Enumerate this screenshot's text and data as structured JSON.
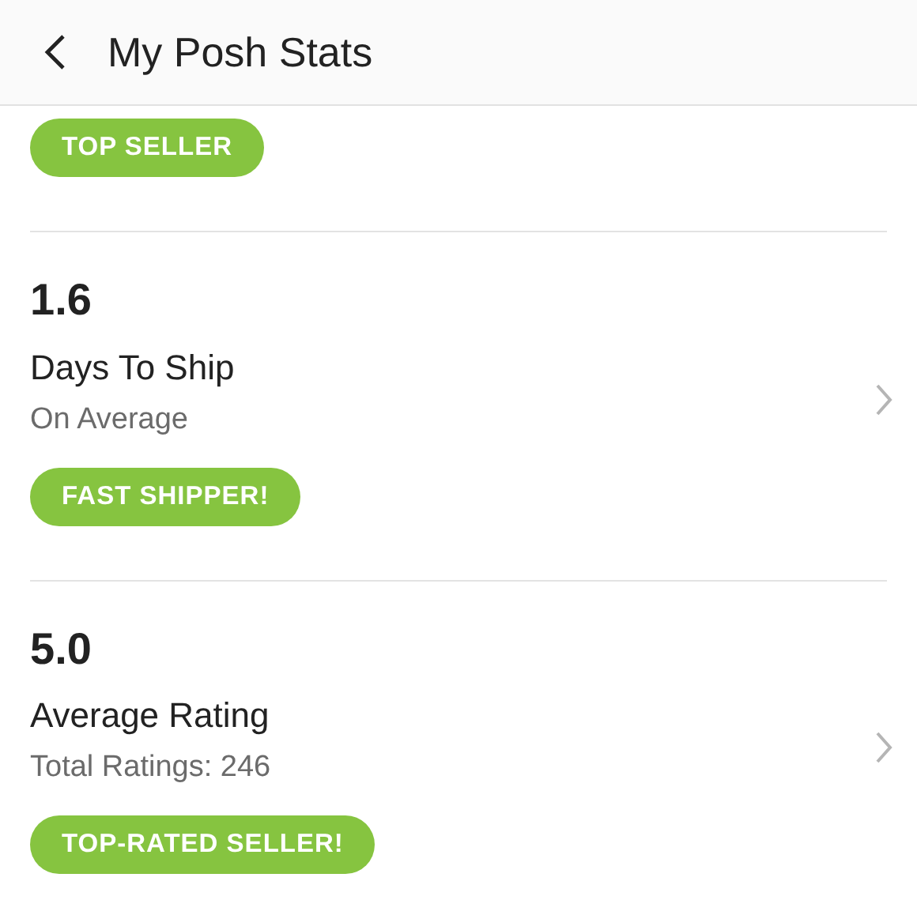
{
  "header": {
    "title": "My Posh Stats"
  },
  "stats": [
    {
      "kind": "partial",
      "badge": "TOP SELLER"
    },
    {
      "kind": "full",
      "value": "1.6",
      "label": "Days To Ship",
      "note": "On Average",
      "badge": "FAST SHIPPER!"
    },
    {
      "kind": "full",
      "value": "5.0",
      "label": "Average Rating",
      "note": "Total Ratings: 246",
      "badge": "TOP-RATED SELLER!"
    }
  ]
}
